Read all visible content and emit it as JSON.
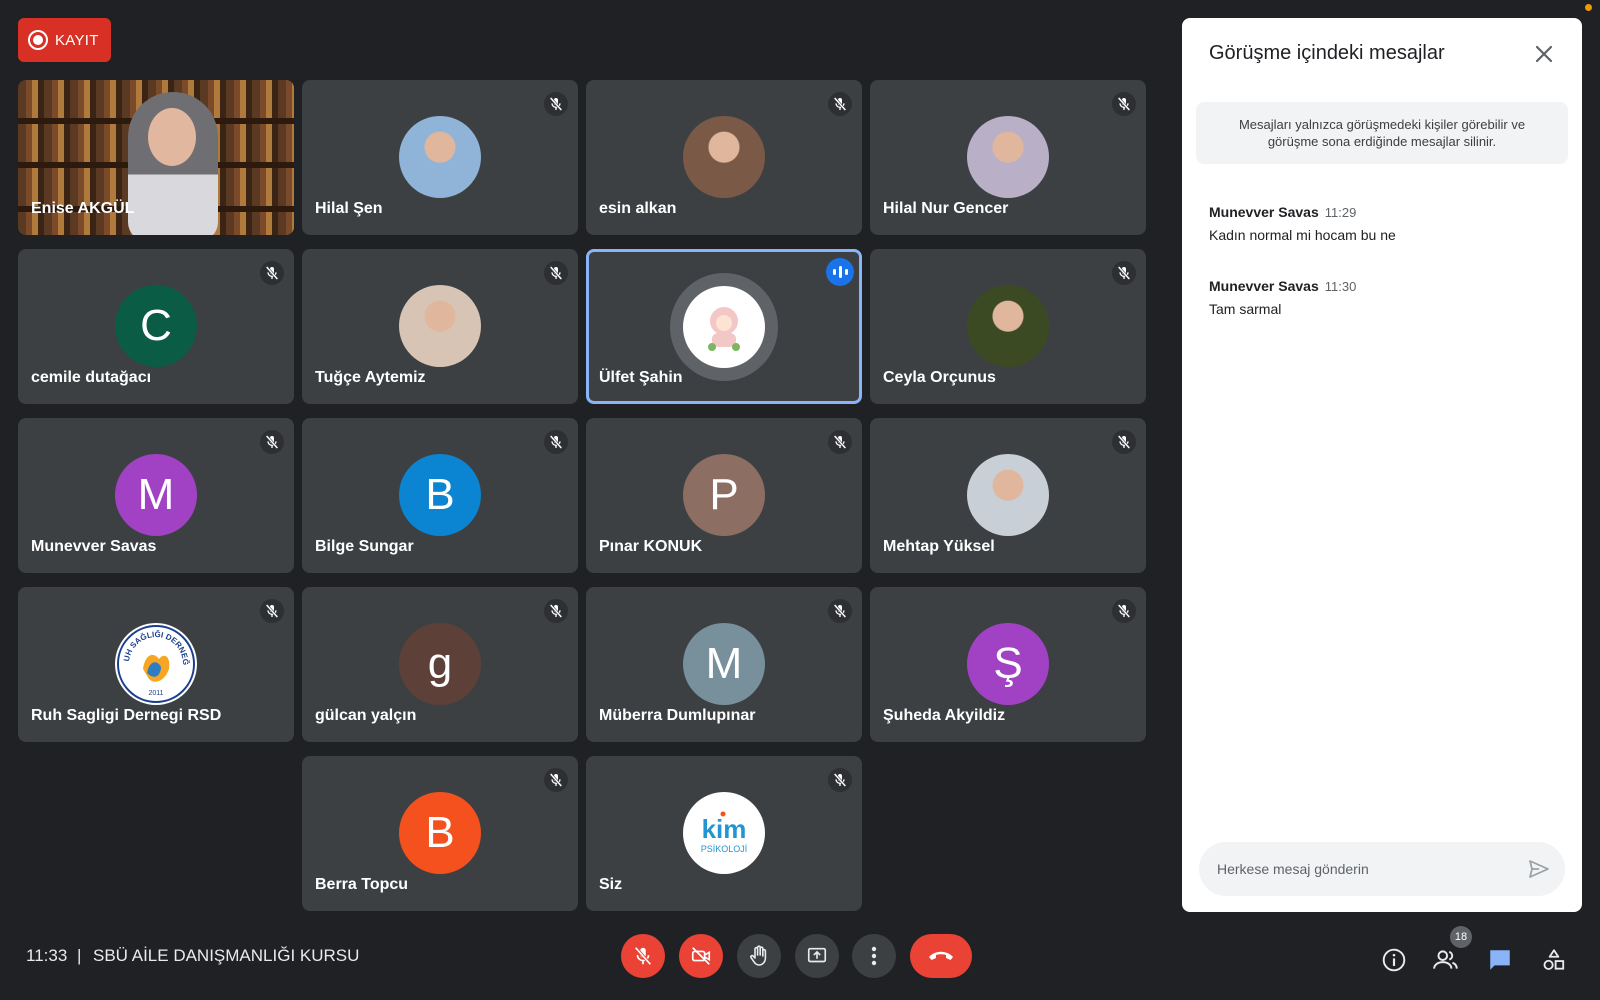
{
  "recording": {
    "label": "KAYIT",
    "color": "#d93025"
  },
  "participants": [
    {
      "name": "Enise AKGÜL",
      "type": "video"
    },
    {
      "name": "Hilal Şen",
      "type": "photo",
      "color": "#8fb4d8"
    },
    {
      "name": "esin alkan",
      "type": "photo",
      "color": "#7a5a46"
    },
    {
      "name": "Hilal Nur Gencer",
      "type": "photo",
      "color": "#b9b0c8"
    },
    {
      "name": "cemile dutağacı",
      "type": "letter",
      "letter": "C",
      "color": "#0b5c45"
    },
    {
      "name": "Tuğçe Aytemiz",
      "type": "photo",
      "color": "#d7c4b5"
    },
    {
      "name": "Ülfet Şahin",
      "type": "ring",
      "speaking": true
    },
    {
      "name": "Ceyla Orçunus",
      "type": "photo",
      "color": "#3b4a22"
    },
    {
      "name": "Munevver Savas",
      "type": "letter",
      "letter": "M",
      "color": "#a142c4"
    },
    {
      "name": "Bilge Sungar",
      "type": "letter",
      "letter": "B",
      "color": "#0b84d1"
    },
    {
      "name": "Pınar KONUK",
      "type": "letter",
      "letter": "P",
      "color": "#8d6e63"
    },
    {
      "name": "Mehtap Yüksel",
      "type": "photo",
      "color": "#c9cfd6"
    },
    {
      "name": "Ruh Sagligi Dernegi RSD",
      "type": "logo"
    },
    {
      "name": "gülcan yalçın",
      "type": "letter",
      "letter": "g",
      "color": "#5d4037"
    },
    {
      "name": "Müberra Dumlupınar",
      "type": "letter",
      "letter": "M",
      "color": "#78909c"
    },
    {
      "name": "Şuheda Akyildiz",
      "type": "letter",
      "letter": "Ş",
      "color": "#a142c4"
    },
    {
      "name": "Berra Topcu",
      "type": "letter",
      "letter": "B",
      "color": "#f4511e"
    },
    {
      "name": "Siz",
      "type": "kim"
    }
  ],
  "chat": {
    "title": "Görüşme içindeki mesajlar",
    "notice": "Mesajları yalnızca görüşmedeki kişiler görebilir ve görüşme sona erdiğinde mesajlar silinir.",
    "messages": [
      {
        "sender": "Munevver Savas",
        "time": "11:29",
        "text": "Kadın normal mi hocam bu ne"
      },
      {
        "sender": "Munevver Savas",
        "time": "11:30",
        "text": "Tam sarmal"
      }
    ],
    "input_placeholder": "Herkese mesaj gönderin"
  },
  "bottom": {
    "time": "11:33",
    "separator": "|",
    "meeting_title": "SBÜ AİLE DANIŞMANLIĞI KURSU",
    "participant_count": "18"
  },
  "logos": {
    "rsd_arc": "RUH SAĞLIĞI DERNEĞİ",
    "rsd_year": "2011",
    "kim_main": "kim",
    "kim_sub": "PSİKOLOJİ"
  },
  "icons": {
    "mic_off": "mic-off-icon",
    "camera_off": "camera-off-icon",
    "hand": "raise-hand-icon",
    "present": "present-icon",
    "more": "more-vert-icon",
    "hangup": "hangup-icon",
    "info": "info-icon",
    "people": "people-icon",
    "chat": "chat-icon",
    "activities": "activities-icon",
    "close": "close-icon",
    "send": "send-icon"
  },
  "colors": {
    "accent": "#1a73e8",
    "danger": "#ea4335",
    "tile": "#3c4043",
    "background": "#202124"
  }
}
